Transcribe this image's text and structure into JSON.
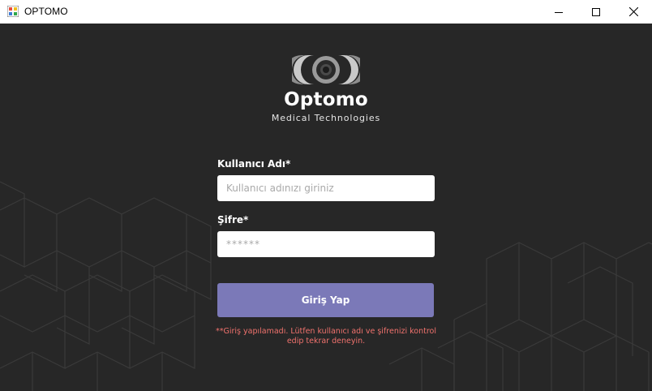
{
  "window": {
    "title": "OPTOMO",
    "icon": "windows-forms-app-icon",
    "controls": [
      "minimize-icon",
      "maximize-icon",
      "close-icon"
    ]
  },
  "brand": {
    "name": "Optomo",
    "tagline": "Medical Technologies"
  },
  "form": {
    "username_label": "Kullanıcı Adı*",
    "username_placeholder": "Kullanıcı adınızı giriniz",
    "username_value": "",
    "password_label": "Şifre*",
    "password_placeholder": "******",
    "password_value": "",
    "submit_label": "Giriş Yap",
    "error_message": "**Giriş yapılamadı. Lütfen kullanıcı adı ve şifrenizi kontrol edip tekrar deneyin."
  },
  "colors": {
    "background": "#272727",
    "button": "#7b79b8",
    "error": "#f0726d",
    "pattern_lines": "#3a3a3a"
  }
}
